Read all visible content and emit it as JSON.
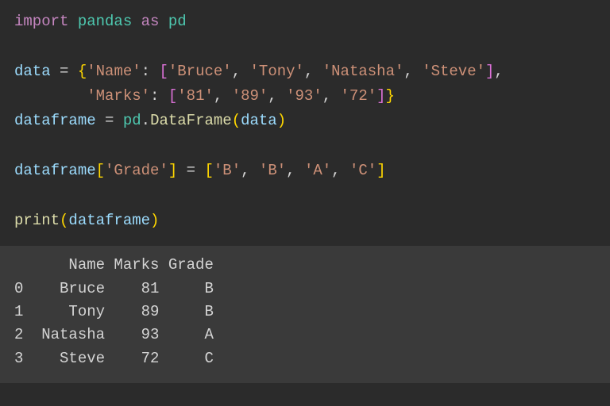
{
  "chart_data": {
    "type": "table",
    "columns": [
      "",
      "Name",
      "Marks",
      "Grade"
    ],
    "rows": [
      [
        "0",
        "Bruce",
        "81",
        "B"
      ],
      [
        "1",
        "Tony",
        "89",
        "B"
      ],
      [
        "2",
        "Natasha",
        "93",
        "A"
      ],
      [
        "3",
        "Steve",
        "72",
        "C"
      ]
    ]
  },
  "code": {
    "line1": {
      "kw1": "import",
      "mod1": "pandas",
      "kw2": "as",
      "mod2": "pd"
    },
    "line3": {
      "var": "data",
      "eq": "=",
      "k1": "'Name'",
      "v1a": "'Bruce'",
      "v1b": "'Tony'",
      "v1c": "'Natasha'",
      "v1d": "'Steve'"
    },
    "line4": {
      "k2": "'Marks'",
      "v2a": "'81'",
      "v2b": "'89'",
      "v2c": "'93'",
      "v2d": "'72'"
    },
    "line5": {
      "var": "dataframe",
      "eq": "=",
      "mod": "pd",
      "fn": "DataFrame",
      "arg": "data"
    },
    "line7": {
      "var": "dataframe",
      "key": "'Grade'",
      "eq": "=",
      "g1": "'B'",
      "g2": "'B'",
      "g3": "'A'",
      "g4": "'C'"
    },
    "line9": {
      "fn": "print",
      "arg": "dataframe"
    }
  },
  "output": {
    "header": "      Name Marks Grade",
    "r0": "0    Bruce    81     B",
    "r1": "1     Tony    89     B",
    "r2": "2  Natasha    93     A",
    "r3": "3    Steve    72     C"
  }
}
